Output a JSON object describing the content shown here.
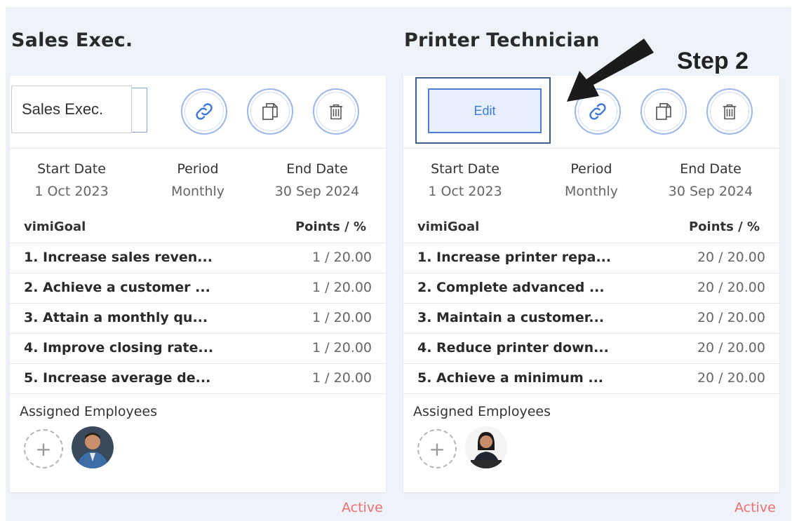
{
  "cards": [
    {
      "title": "Sales Exec.",
      "name_value": "Sales Exec.",
      "start_date_label": "Start Date",
      "start_date": "1 Oct 2023",
      "period_label": "Period",
      "period": "Monthly",
      "end_date_label": "End Date",
      "end_date": "30 Sep 2024",
      "goal_header": "vimiGoal",
      "points_header": "Points / %",
      "goals": [
        {
          "label": "1. Increase sales reven...",
          "points": "1 / 20.00"
        },
        {
          "label": "2. Achieve a customer ...",
          "points": "1 / 20.00"
        },
        {
          "label": "3. Attain a monthly qu...",
          "points": "1 / 20.00"
        },
        {
          "label": "4. Improve closing rate...",
          "points": "1 / 20.00"
        },
        {
          "label": "5. Increase average de...",
          "points": "1 / 20.00"
        }
      ],
      "assigned_label": "Assigned Employees",
      "status": "Active"
    },
    {
      "title": "Printer Technician",
      "edit_label": "Edit",
      "start_date_label": "Start Date",
      "start_date": "1 Oct 2023",
      "period_label": "Period",
      "period": "Monthly",
      "end_date_label": "End Date",
      "end_date": "30 Sep 2024",
      "goal_header": "vimiGoal",
      "points_header": "Points / %",
      "goals": [
        {
          "label": "1. Increase printer repa...",
          "points": "20 / 20.00"
        },
        {
          "label": "2. Complete advanced ...",
          "points": "20 / 20.00"
        },
        {
          "label": "3. Maintain a customer...",
          "points": "20 / 20.00"
        },
        {
          "label": "4. Reduce printer down...",
          "points": "20 / 20.00"
        },
        {
          "label": "5. Achieve a minimum ...",
          "points": "20 / 20.00"
        }
      ],
      "assigned_label": "Assigned Employees",
      "status": "Active"
    }
  ],
  "annotation": {
    "step_label": "Step 2"
  },
  "icons": [
    "link-icon",
    "copy-icon",
    "trash-icon",
    "plus-icon",
    "arrow-icon"
  ],
  "colors": {
    "accent": "#4a7fd4",
    "status_active": "#f06f6f",
    "background": "#eef3fa"
  }
}
